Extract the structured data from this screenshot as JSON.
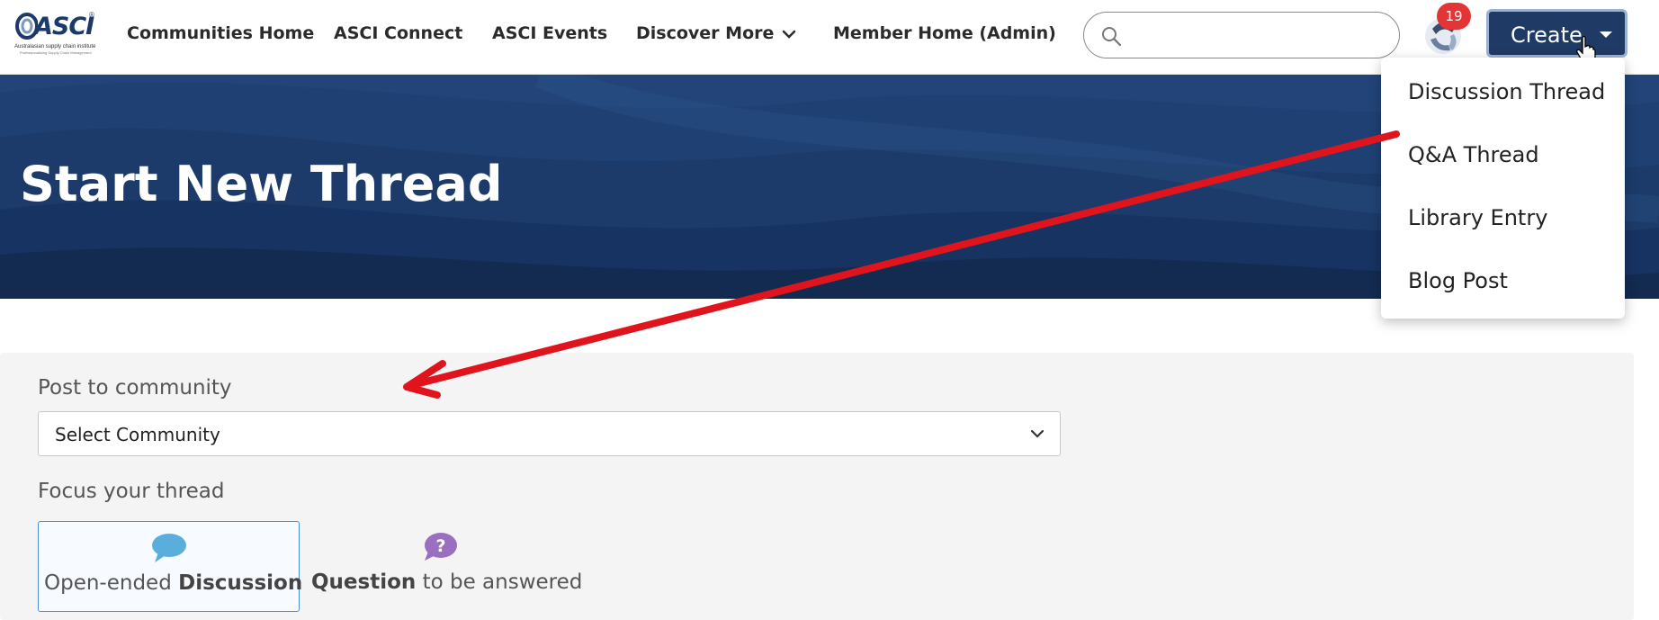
{
  "brand": {
    "logo_text": "ASCI",
    "logo_subtitle": "Australasian supply chain institute",
    "logo_tagline": "Professionalising Supply Chain Management"
  },
  "nav": {
    "items": [
      {
        "label": "Communities Home"
      },
      {
        "label": "ASCI Connect"
      },
      {
        "label": "ASCI Events"
      },
      {
        "label": "Discover More"
      },
      {
        "label": "Member Home (Admin)"
      }
    ]
  },
  "search": {
    "placeholder": "",
    "value": ""
  },
  "notifications": {
    "count": "19"
  },
  "create": {
    "label": "Create",
    "menu": [
      {
        "label": "Discussion Thread"
      },
      {
        "label": "Q&A Thread"
      },
      {
        "label": "Library Entry"
      },
      {
        "label": "Blog Post"
      }
    ]
  },
  "hero": {
    "title": "Start New Thread"
  },
  "form": {
    "community_label": "Post to community",
    "community_value": "Select Community",
    "focus_label": "Focus your thread",
    "focus_options": [
      {
        "prefix": "Open-ended ",
        "bold": "Discussion",
        "suffix": "",
        "selected": true
      },
      {
        "prefix": "",
        "bold": "Question",
        "suffix": " to be answered",
        "selected": false
      }
    ]
  },
  "colors": {
    "accent": "#1f3a64",
    "hero_bg": "#1a3763",
    "badge": "#e23535",
    "annotation_arrow": "#e0141c",
    "discussion_icon": "#5aaedc",
    "question_icon": "#9b6fc0"
  },
  "icons": {
    "search": "search-icon",
    "chevron": "chevron-down-icon",
    "discussion": "speech-bubble-icon",
    "question": "question-bubble-icon"
  }
}
